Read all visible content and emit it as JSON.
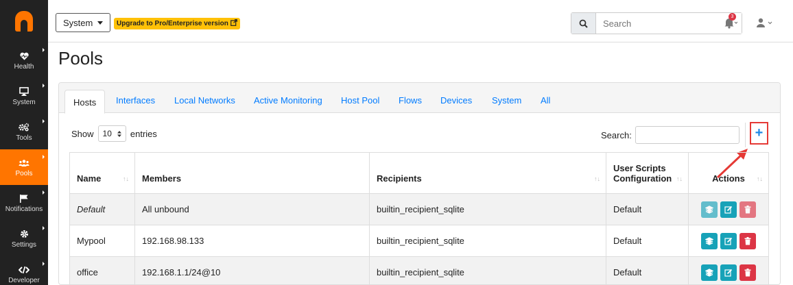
{
  "sidebar": {
    "items": [
      {
        "label": "Health",
        "icon": "heartbeat-icon"
      },
      {
        "label": "System",
        "icon": "desktop-icon"
      },
      {
        "label": "Tools",
        "icon": "cogs-icon"
      },
      {
        "label": "Pools",
        "icon": "users-icon",
        "active": true
      },
      {
        "label": "Notifications",
        "icon": "flag-icon"
      },
      {
        "label": "Settings",
        "icon": "cog-icon"
      },
      {
        "label": "Developer",
        "icon": "code-icon"
      }
    ]
  },
  "topbar": {
    "system_label": "System",
    "upgrade_label": "Upgrade to Pro/Enterprise version",
    "search_placeholder": "Search",
    "notification_count": "3"
  },
  "page": {
    "title": "Pools"
  },
  "tabs": [
    "Hosts",
    "Interfaces",
    "Local Networks",
    "Active Monitoring",
    "Host Pool",
    "Flows",
    "Devices",
    "System",
    "All"
  ],
  "table_controls": {
    "show_label": "Show",
    "entries_value": "10",
    "entries_label": "entries",
    "search_label": "Search:",
    "add_label": "+"
  },
  "table": {
    "headers": [
      "Name",
      "Members",
      "Recipients",
      "User Scripts Configuration",
      "Actions"
    ],
    "rows": [
      {
        "name": "Default",
        "members": "All unbound",
        "recipients": "builtin_recipient_sqlite",
        "config": "Default"
      },
      {
        "name": "Mypool",
        "members": "192.168.98.133",
        "recipients": "builtin_recipient_sqlite",
        "config": "Default"
      },
      {
        "name": "office",
        "members": "192.168.1.1/24@10",
        "recipients": "builtin_recipient_sqlite",
        "config": "Default"
      }
    ]
  },
  "colors": {
    "accent": "#ff7500",
    "link": "#007bff",
    "teal": "#17a2b8",
    "danger": "#dc3545",
    "highlight": "#e53935"
  }
}
